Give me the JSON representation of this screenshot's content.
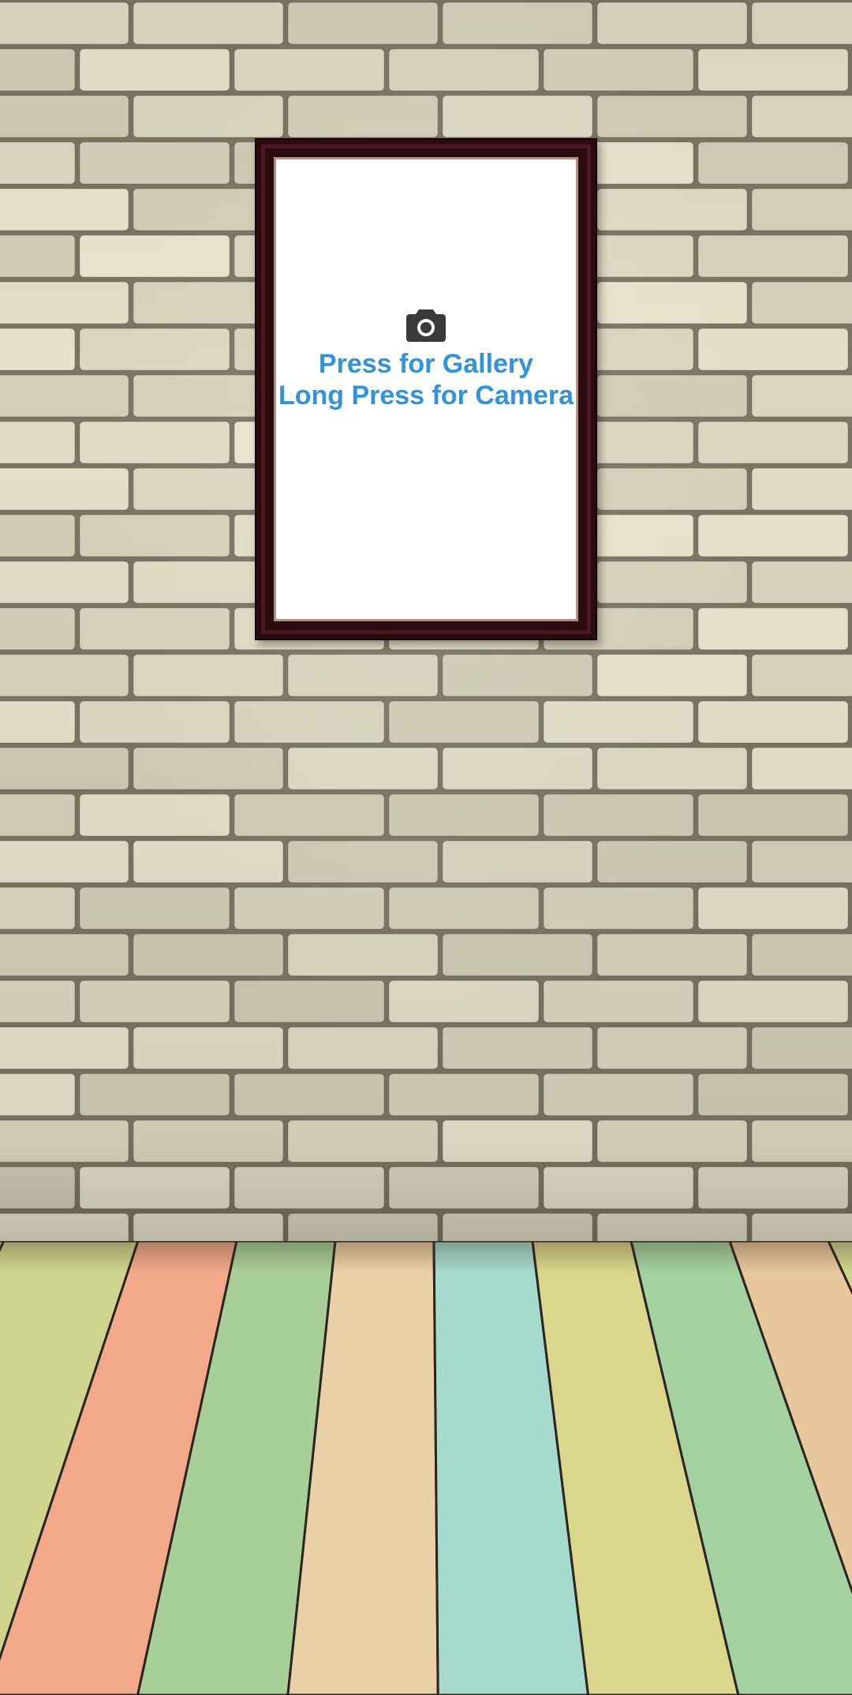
{
  "picture_frame": {
    "icon": "camera-icon",
    "primary_text": "Press for Gallery",
    "secondary_text": "Long Press for Camera"
  },
  "colors": {
    "prompt_text": "#3093dc",
    "frame": "#2a0c10",
    "icon": "#3a3a3a",
    "wall_brick": "#dcd8c3",
    "floor_planks": [
      "#e8c79c",
      "#cfd58e",
      "#f2a98a",
      "#a9cf98",
      "#ead0a6",
      "#a6dacd",
      "#dad68b",
      "#a3d1a0"
    ]
  }
}
